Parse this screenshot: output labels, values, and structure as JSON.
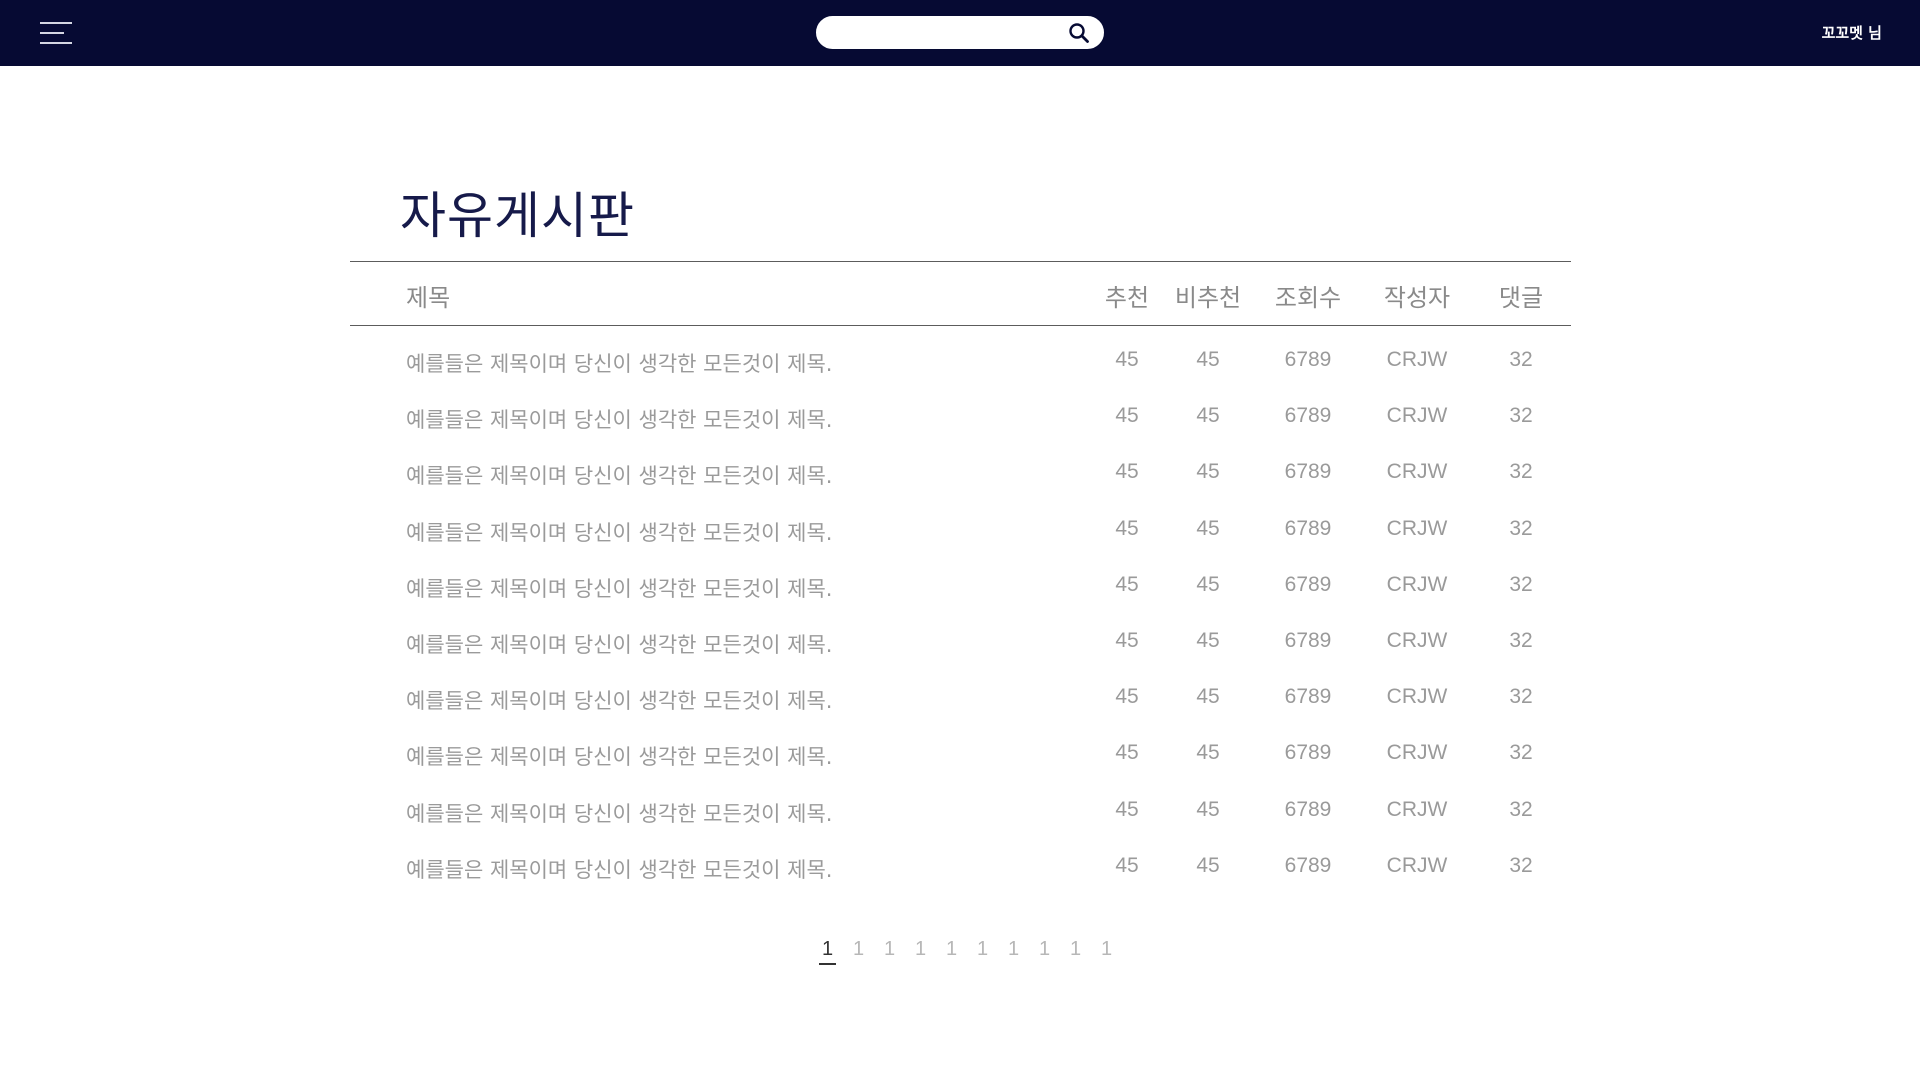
{
  "header": {
    "search": {
      "value": "",
      "placeholder": ""
    },
    "user_name": "꼬꼬멧 님"
  },
  "page_title": "자유게시판",
  "board": {
    "columns": {
      "title": "제목",
      "upvotes": "추천",
      "downvotes": "비추천",
      "views": "조회수",
      "author": "작성자",
      "comments": "댓글"
    },
    "rows": [
      {
        "title": "예를들은 제목이며 당신이 생각한 모든것이 제목.",
        "upvotes": "45",
        "downvotes": "45",
        "views": "6789",
        "author": "CRJW",
        "comments": "32"
      },
      {
        "title": "예를들은 제목이며 당신이 생각한 모든것이 제목.",
        "upvotes": "45",
        "downvotes": "45",
        "views": "6789",
        "author": "CRJW",
        "comments": "32"
      },
      {
        "title": "예를들은 제목이며 당신이 생각한 모든것이 제목.",
        "upvotes": "45",
        "downvotes": "45",
        "views": "6789",
        "author": "CRJW",
        "comments": "32"
      },
      {
        "title": "예를들은 제목이며 당신이 생각한 모든것이 제목.",
        "upvotes": "45",
        "downvotes": "45",
        "views": "6789",
        "author": "CRJW",
        "comments": "32"
      },
      {
        "title": "예를들은 제목이며 당신이 생각한 모든것이 제목.",
        "upvotes": "45",
        "downvotes": "45",
        "views": "6789",
        "author": "CRJW",
        "comments": "32"
      },
      {
        "title": "예를들은 제목이며 당신이 생각한 모든것이 제목.",
        "upvotes": "45",
        "downvotes": "45",
        "views": "6789",
        "author": "CRJW",
        "comments": "32"
      },
      {
        "title": "예를들은 제목이며 당신이 생각한 모든것이 제목.",
        "upvotes": "45",
        "downvotes": "45",
        "views": "6789",
        "author": "CRJW",
        "comments": "32"
      },
      {
        "title": "예를들은 제목이며 당신이 생각한 모든것이 제목.",
        "upvotes": "45",
        "downvotes": "45",
        "views": "6789",
        "author": "CRJW",
        "comments": "32"
      },
      {
        "title": "예를들은 제목이며 당신이 생각한 모든것이 제목.",
        "upvotes": "45",
        "downvotes": "45",
        "views": "6789",
        "author": "CRJW",
        "comments": "32"
      },
      {
        "title": "예를들은 제목이며 당신이 생각한 모든것이 제목.",
        "upvotes": "45",
        "downvotes": "45",
        "views": "6789",
        "author": "CRJW",
        "comments": "32"
      }
    ]
  },
  "pagination": {
    "pages": [
      "1",
      "1",
      "1",
      "1",
      "1",
      "1",
      "1",
      "1",
      "1",
      "1"
    ],
    "active_index": 0
  },
  "icons": {
    "menu": "hamburger-menu-icon",
    "search": "search-icon"
  },
  "colors": {
    "header_bg": "#060a33",
    "title_color": "#161a4a",
    "row_text": "#9a9a9a"
  }
}
